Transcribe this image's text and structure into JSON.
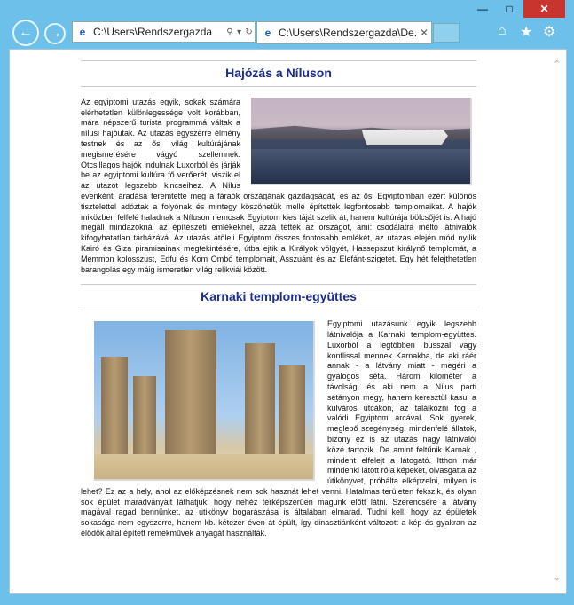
{
  "window": {
    "minimize_icon": "minimize-icon",
    "maximize_icon": "maximize-icon",
    "close_icon": "close-icon"
  },
  "browser": {
    "address": "C:\\Users\\Rendszergazda",
    "tab_title": "C:\\Users\\Rendszergazda\\De...",
    "icons": [
      "back-icon",
      "forward-icon",
      "ie-icon",
      "search-icon",
      "refresh-icon",
      "close-icon",
      "home-icon",
      "star-icon",
      "gear-icon"
    ]
  },
  "page": {
    "section1": {
      "title": "Hajózás a Níluson",
      "text": "Az egyiptomi utazás egyik, sokak számára elérhetetlen különlegessége volt korábban, mára népszerű turista programmá váltak a nílusi hajóutak. Az utazás egyszerre élmény testnek és az ősi világ kultúrájának megismerésére vágyó szellemnek. Ötcsillagos hajók indulnak Luxorból és járják be az egyiptomi kultúra fő verőerét, viszik el az utazót legszebb kincseihez. A Nílus évenkénti áradása teremtette meg a fáraók országának gazdagságát, és az ősi Egyiptomban ezért különös tisztelettel adóztak a folyónak és mintegy köszönetük mellé építették legfontosabb templomaikat. A hajók miközben felfelé haladnak a Níluson nemcsak Egyiptom kies táját szelik át, hanem kultúrája bölcsőjét is. A hajó megáll mindazoknál az építészeti emlékeknél, azzá tették az országot, ami: csodálatra méltó látnivalók kifogyhatatlan tárházává. Az utazás átöleli Egyiptom összes fontosabb emlékét, az utazás elején mód nyílik Kairó és Giza piramisainak megtekintésére, útba ejtik a Királyok völgyét, Hassepszut királynő templomát, a Memmon kolosszust, Edfu és Kom Ombó templomait, Asszuánt és az Elefánt-szigetet. Egy hét felejthetetlen barangolás egy máig ismeretlen világ relikviái között."
    },
    "section2": {
      "title": "Karnaki templom-együttes",
      "text": "Egyiptomi utazásunk egyik legszebb látnivalója a Karnaki templom-együttes. Luxorból a legtöbben busszal vagy konflissal mennek Karnakba, de aki ráér annak - a látvány miatt - megéri a gyalogos séta. Három kilométer a távolság, és aki nem a Nílus parti sétányon megy, hanem keresztül kasul a kulváros utcákon, az találkozni fog a valódi Egyiptom arcával. Sok gyerek, meglepő szegénység, mindenfelé állatok, bizony ez is az utazás nagy látnivalói közé tartozik. De amint feltűnik Karnak , mindent elfelejt a látogató. Itthon már mindenki látott róla képeket, olvasgatta az útikönyvet, próbálta elképzelni, milyen is lehet? Ez az a hely, ahol az előképzésnek nem sok hasznát lehet venni. Hatalmas területen fekszik, és olyan sok épület maradványait láthatjuk, hogy nehéz térképszerűen magunk előtt látni. Szerencsére a látvány magával ragad bennünket, az útikönyv bogarászása is általában elmarad. Tudni kell, hogy az épületek sokasága nem egyszerre, hanem kb. kétezer éven át épült, így dinasztiánként változott a kép és gyakran az elődök által épített remekművek anyagát használták."
    }
  }
}
